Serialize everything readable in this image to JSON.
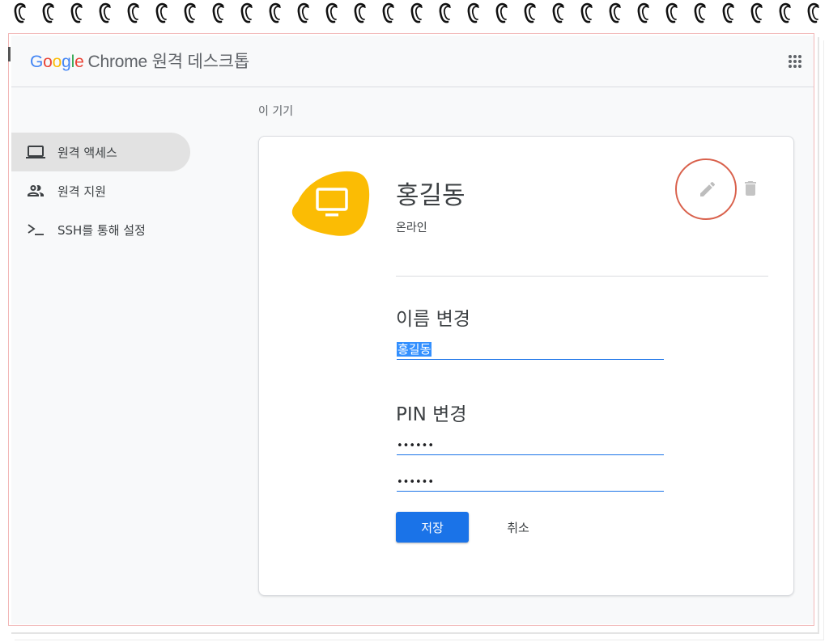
{
  "header": {
    "logo_letters": [
      "G",
      "o",
      "o",
      "g",
      "l",
      "e"
    ],
    "product_name": "Chrome 원격 데스크톱",
    "apps_icon": "apps-grid-icon"
  },
  "sidebar": {
    "items": [
      {
        "label": "원격 액세스",
        "icon": "laptop-icon",
        "active": true
      },
      {
        "label": "원격 지원",
        "icon": "people-icon",
        "active": false
      },
      {
        "label": "SSH를 통해 설정",
        "icon": "terminal-icon",
        "active": false
      }
    ]
  },
  "main": {
    "section_label": "이 기기",
    "device": {
      "name": "홍길동",
      "status": "온라인",
      "icon": "monitor-icon",
      "accent_color": "#fbbc04"
    },
    "actions": {
      "edit_icon": "pencil-icon",
      "delete_icon": "trash-icon"
    },
    "rename": {
      "heading": "이름 변경",
      "value": "홍길동"
    },
    "pin": {
      "heading": "PIN 변경",
      "pin_value": "••••••",
      "confirm_value": "••••••"
    },
    "buttons": {
      "save_label": "저장",
      "cancel_label": "취소"
    }
  },
  "colors": {
    "primary": "#1a73e8",
    "highlight_ring": "#d9614c",
    "device_blob": "#fbbc04"
  }
}
